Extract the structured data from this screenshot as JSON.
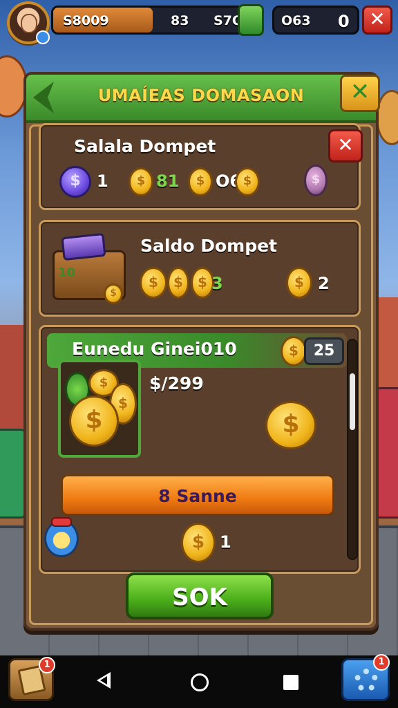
{
  "topbar": {
    "resource_value": "S8009",
    "resource_fill": 0.49,
    "stat_a": "83",
    "stat_b": "S7O",
    "gem_value": "O63",
    "gem_count": "0",
    "close_symbol": "✕"
  },
  "panel": {
    "title": "UMAÍEAS DOMASAON",
    "close_symbol": "✕"
  },
  "wallet_top": {
    "title": "Salala Dompet",
    "close_symbol": "✕",
    "values": [
      "1",
      "81",
      "O6"
    ]
  },
  "wallet": {
    "title": "Saldo Dompet",
    "chest_number": "10",
    "coin_value_a": "3",
    "coin_value_b": "2"
  },
  "offer": {
    "title": "Eunedu Ginei010",
    "badge": "25",
    "price": "$/299",
    "buy_label": "8 Sanne",
    "reward_count": "1"
  },
  "confirm": {
    "label": "SOK"
  },
  "nav": {
    "book_badge": "1",
    "settings_badge": "1"
  },
  "icons": {
    "coin_symbol": "$",
    "accent_green": "#4ea83a",
    "accent_orange": "#f07a12",
    "close_red": "#c0231a"
  }
}
